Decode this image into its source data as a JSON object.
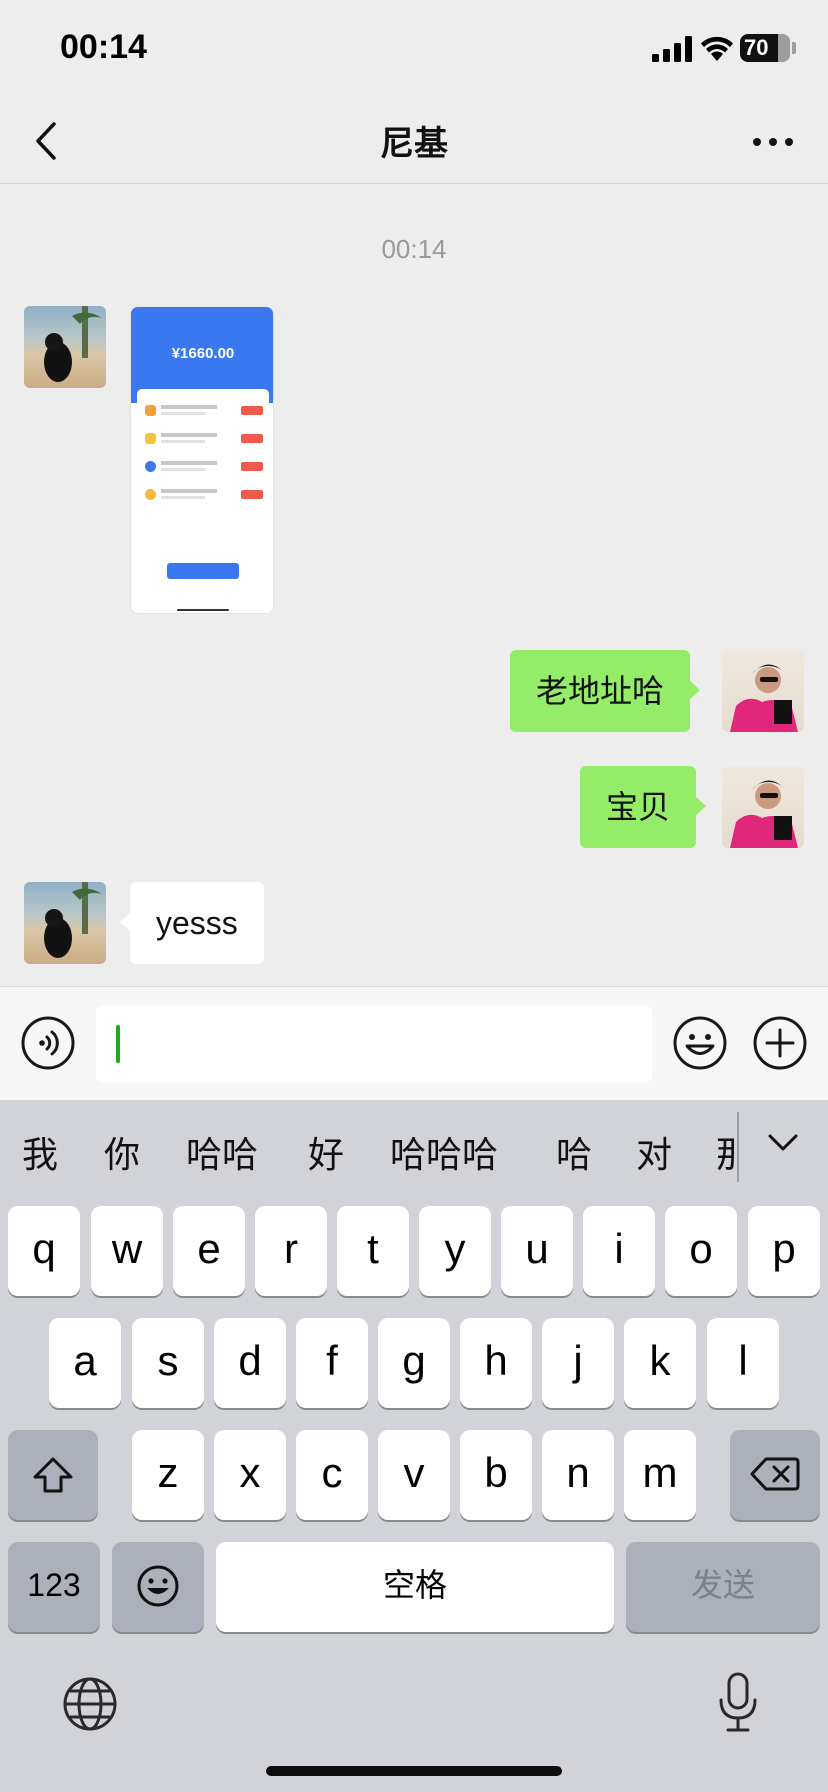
{
  "status_bar": {
    "time": "00:14",
    "battery": "70"
  },
  "header": {
    "title": "尼基"
  },
  "chat": {
    "timestamp": "00:14",
    "screenshot": {
      "amount": "¥1660.00"
    },
    "messages": [
      {
        "side": "right",
        "text": "老地址哈"
      },
      {
        "side": "right",
        "text": "宝贝"
      },
      {
        "side": "left",
        "text": "yesss"
      }
    ]
  },
  "input": {
    "value": ""
  },
  "keyboard": {
    "candidates": [
      "我",
      "你",
      "哈哈",
      "好",
      "哈哈哈",
      "哈",
      "对",
      "那"
    ],
    "row1": [
      "q",
      "w",
      "e",
      "r",
      "t",
      "y",
      "u",
      "i",
      "o",
      "p"
    ],
    "row2": [
      "a",
      "s",
      "d",
      "f",
      "g",
      "h",
      "j",
      "k",
      "l"
    ],
    "row3": [
      "z",
      "x",
      "c",
      "v",
      "b",
      "n",
      "m"
    ],
    "numbers_label": "123",
    "space_label": "空格",
    "send_label": "发送"
  },
  "colors": {
    "outgoing_bubble": "#95ec69",
    "incoming_bubble": "#ffffff",
    "caret": "#1aad19",
    "screenshot_accent": "#3a78f2"
  },
  "icons": [
    "chevron-left-icon",
    "more-icon",
    "voice-icon",
    "emoji-icon",
    "plus-icon",
    "shift-icon",
    "backspace-icon",
    "globe-icon",
    "microphone-icon"
  ]
}
